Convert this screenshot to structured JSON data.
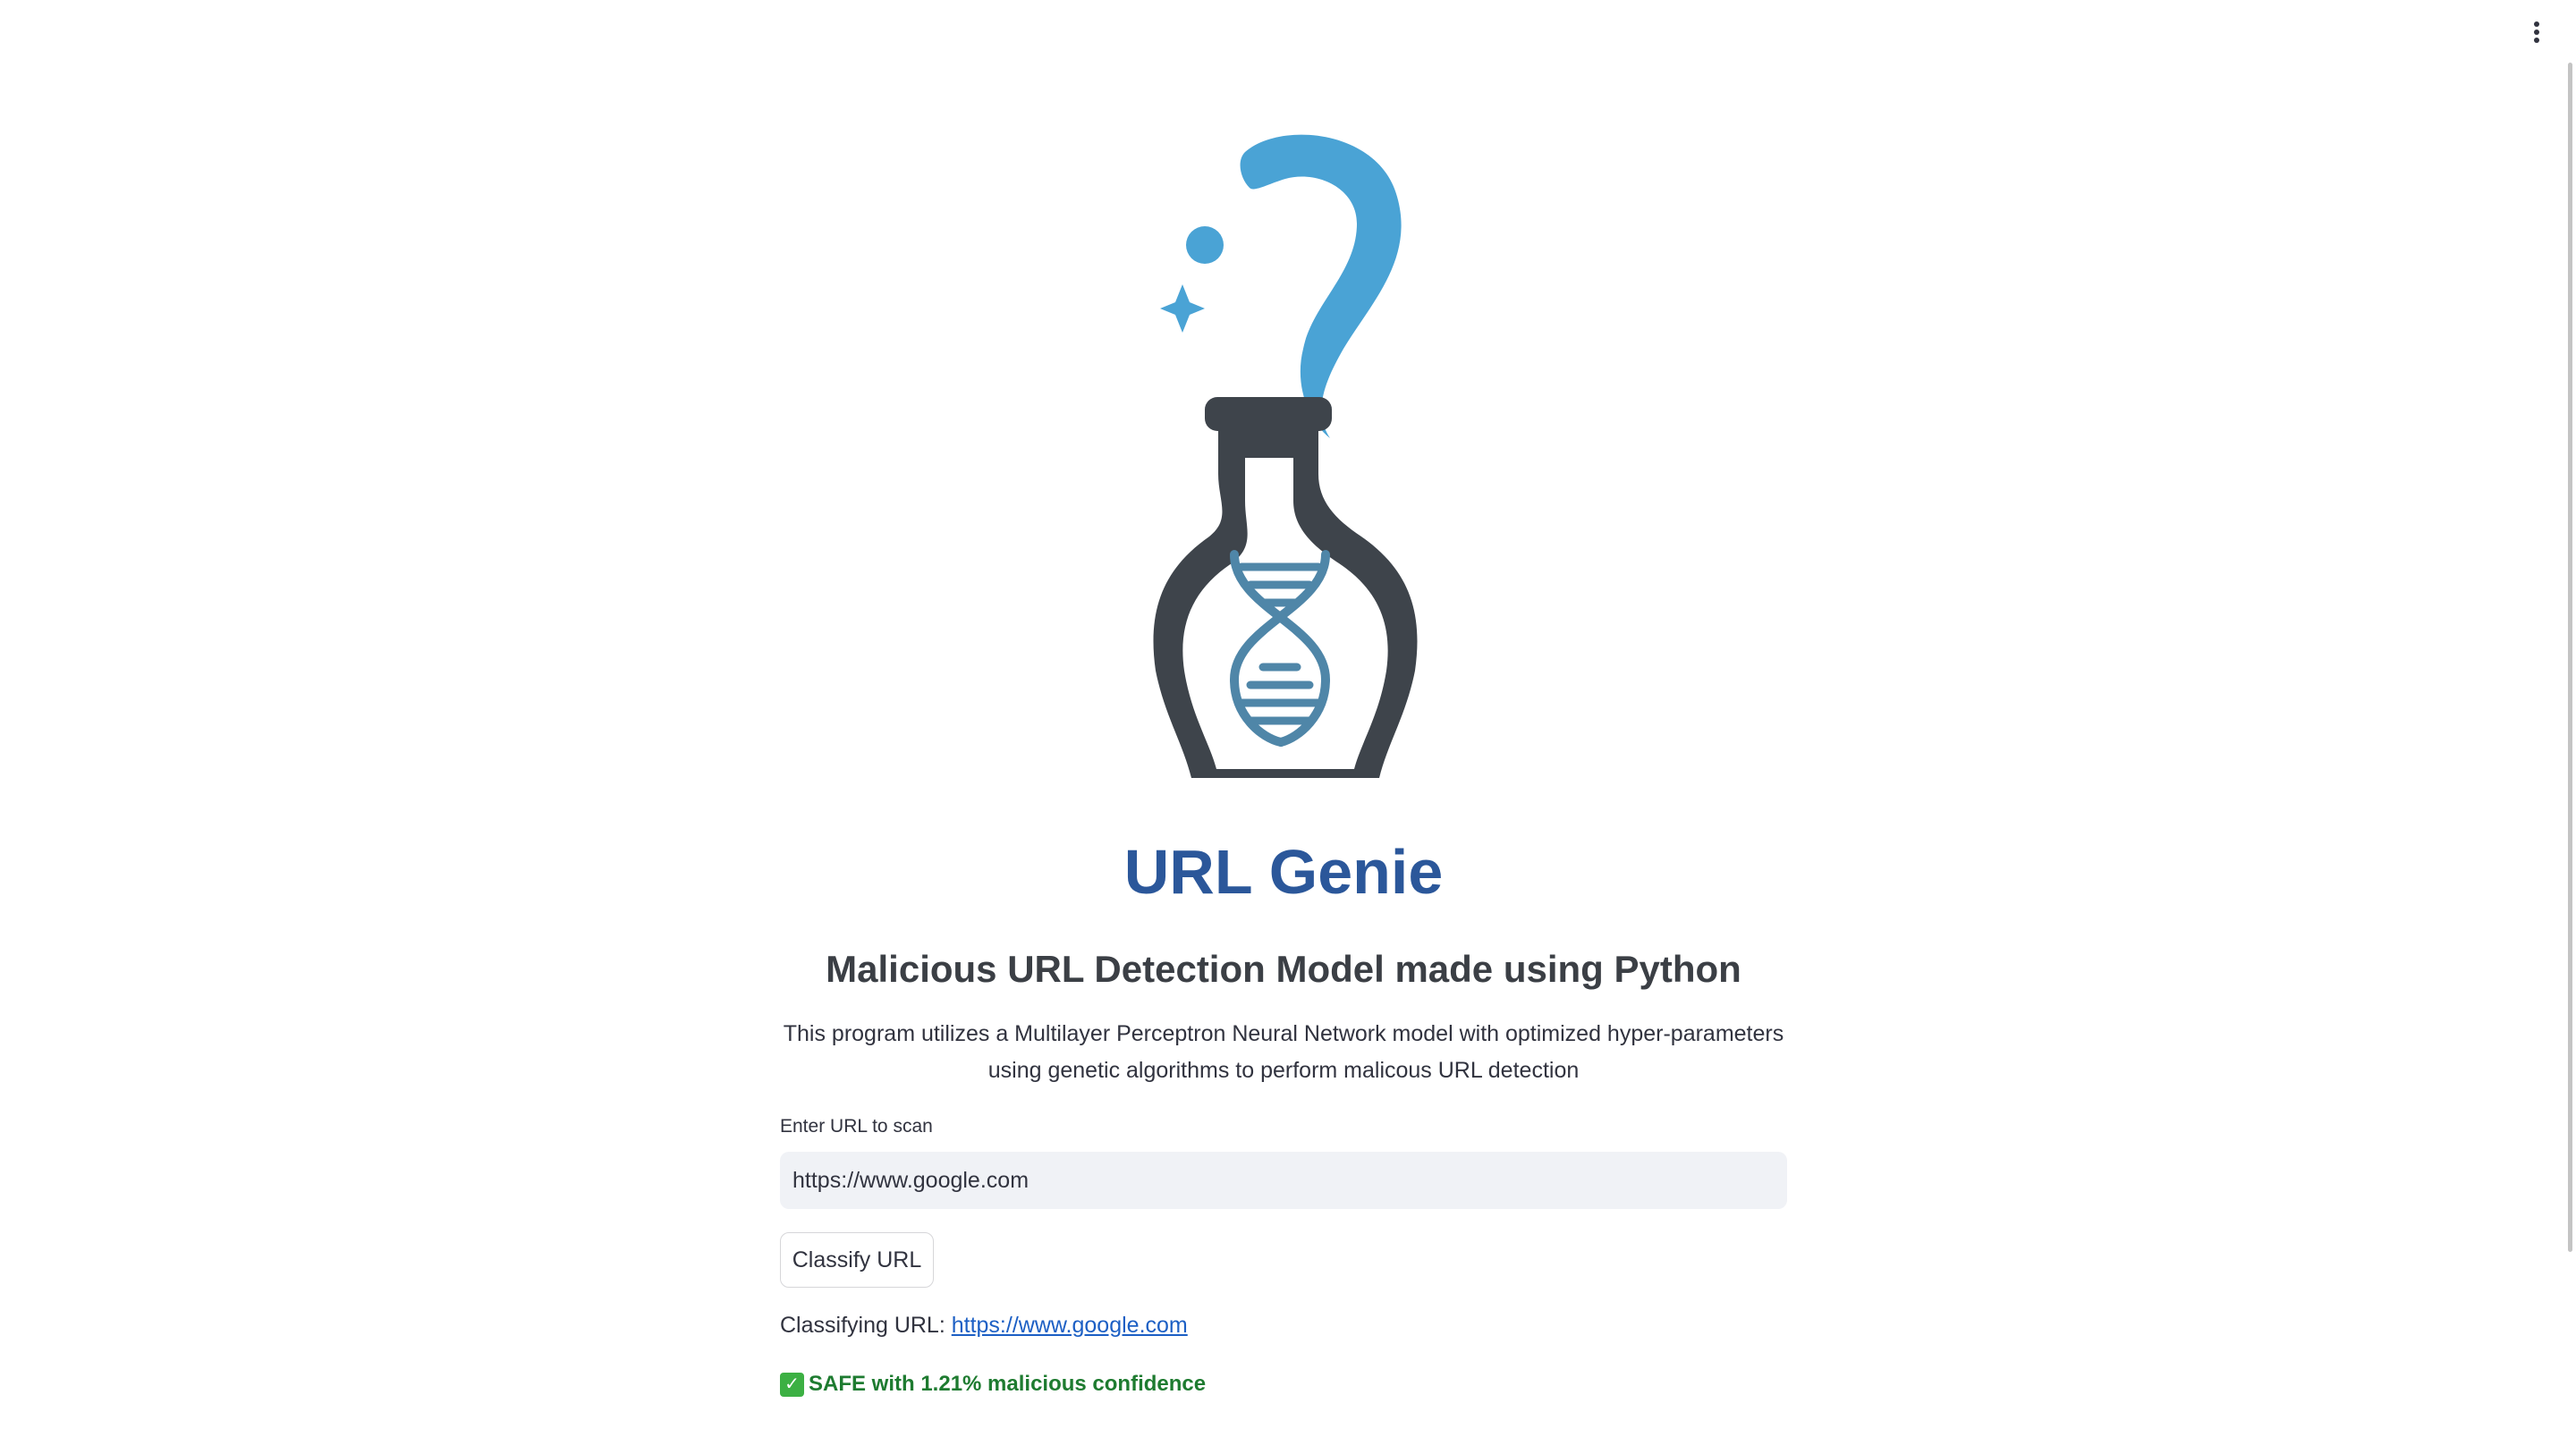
{
  "header": {
    "menu_icon": "vertical-ellipsis-icon"
  },
  "logo": {
    "icon": "genie-bottle-dna-icon",
    "colors": {
      "smoke": "#4aa3d5",
      "bottle": "#3e444b",
      "dna": "#4f86a8"
    }
  },
  "main": {
    "title": "URL Genie",
    "subtitle": "Malicious URL Detection Model made using Python",
    "description": "This program utilizes a Multilayer Perceptron Neural Network model with optimized hyper-parameters using genetic algorithms to perform malicous URL detection"
  },
  "form": {
    "input_label": "Enter URL to scan",
    "input_value": "https://www.google.com",
    "button_label": "Classify URL"
  },
  "result": {
    "classifying_label": "Classifying URL:",
    "classifying_url": "https://www.google.com",
    "status_icon": "check-mark-icon",
    "status_text": "SAFE with 1.21% malicious confidence",
    "status_color": "#1e7b30"
  },
  "colors": {
    "title": "#2b579a",
    "link": "#1c5fc4",
    "input_bg": "#f0f2f6"
  }
}
